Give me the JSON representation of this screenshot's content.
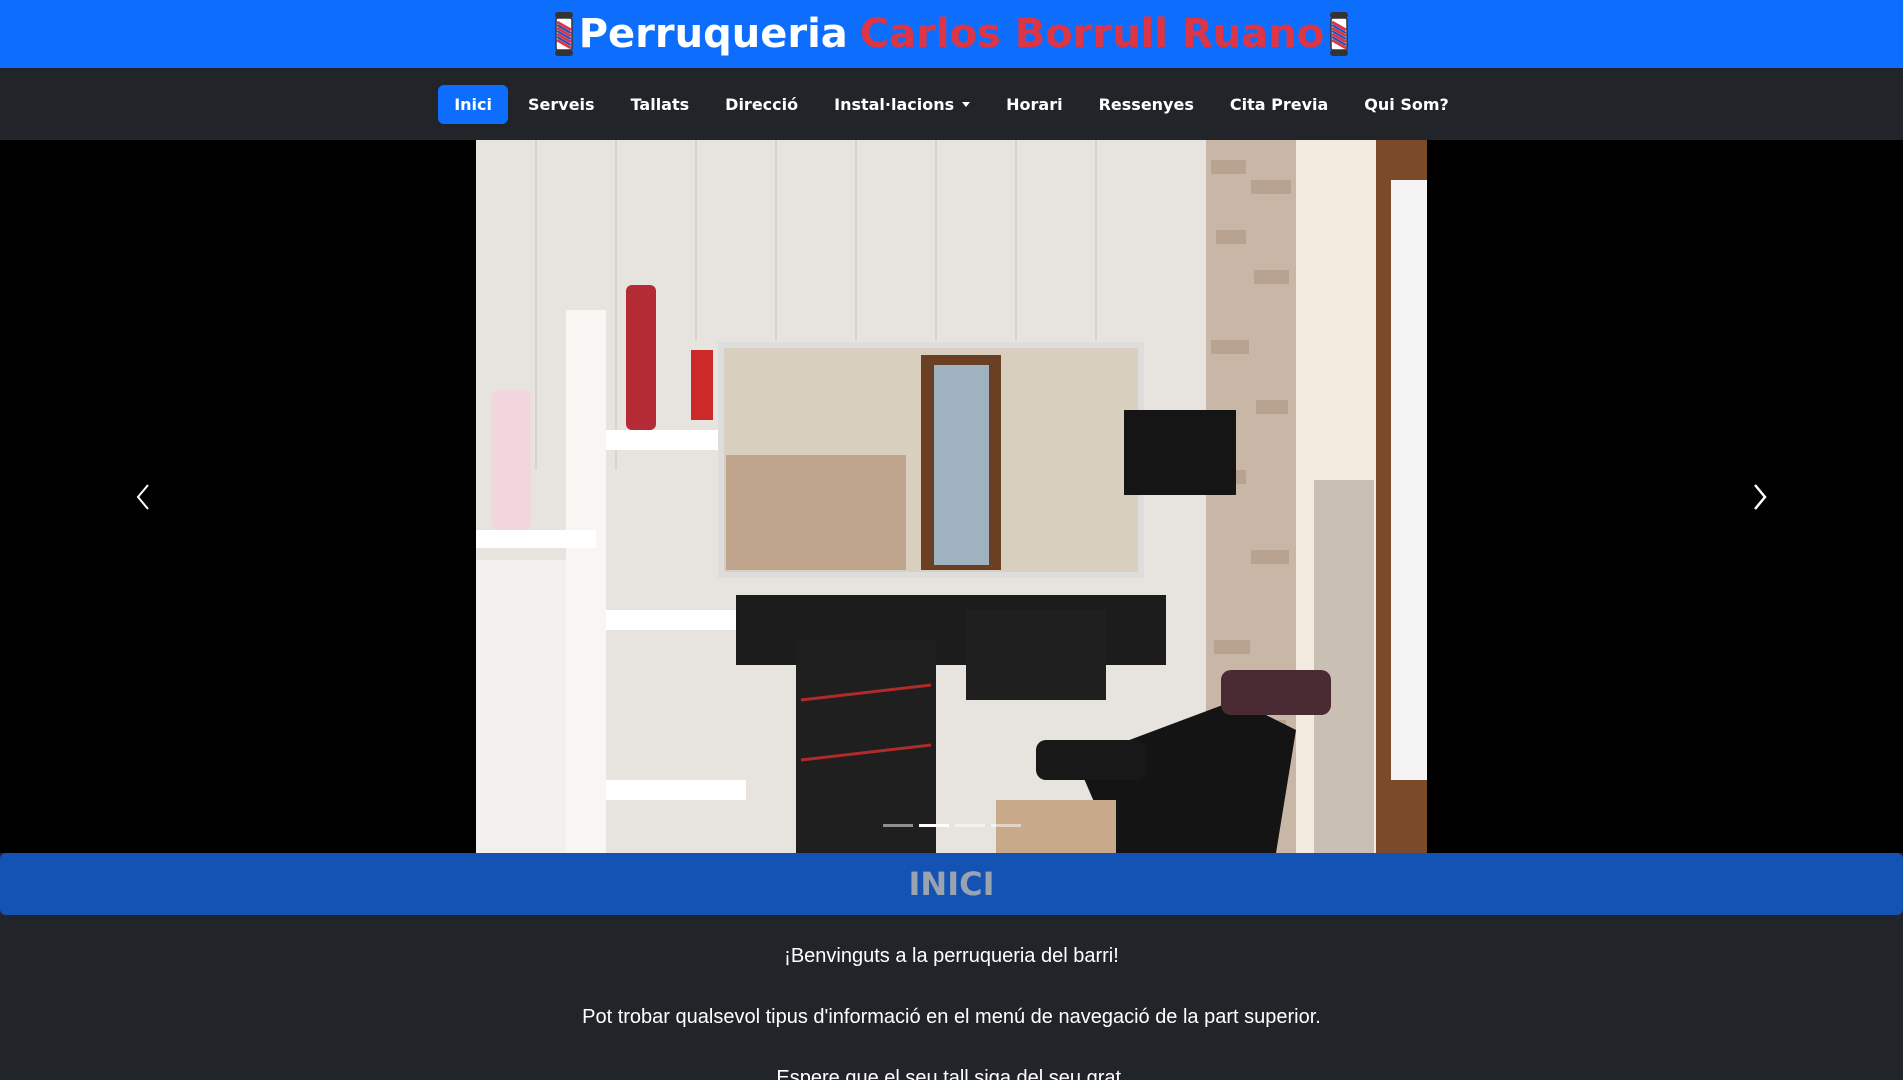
{
  "header": {
    "title_white": "Perruqueria",
    "title_red": "Carlos Borrull Ruano",
    "left_icon": "barber-pole-icon",
    "right_icon": "barber-pole-icon",
    "accent": "#0d6efd",
    "name_color": "#dc3545"
  },
  "nav": {
    "items": [
      {
        "label": "Inici",
        "active": true
      },
      {
        "label": "Serveis"
      },
      {
        "label": "Tallats"
      },
      {
        "label": "Direcció"
      },
      {
        "label": "Instal·lacions",
        "dropdown": true
      },
      {
        "label": "Horari"
      },
      {
        "label": "Ressenyes"
      },
      {
        "label": "Cita Previa"
      },
      {
        "label": "Qui Som?"
      }
    ]
  },
  "carousel": {
    "prev_icon": "chevron-left-icon",
    "next_icon": "chevron-right-icon",
    "slide_count": 4,
    "active_slide": 2
  },
  "section": {
    "title": "INICI"
  },
  "content": {
    "line1": "¡Benvinguts a la perruqueria del barri!",
    "line2": "Pot trobar qualsevol tipus d'informació en el menú de navegació de la part superior.",
    "line3": "Espere que el seu tall siga del seu grat."
  }
}
